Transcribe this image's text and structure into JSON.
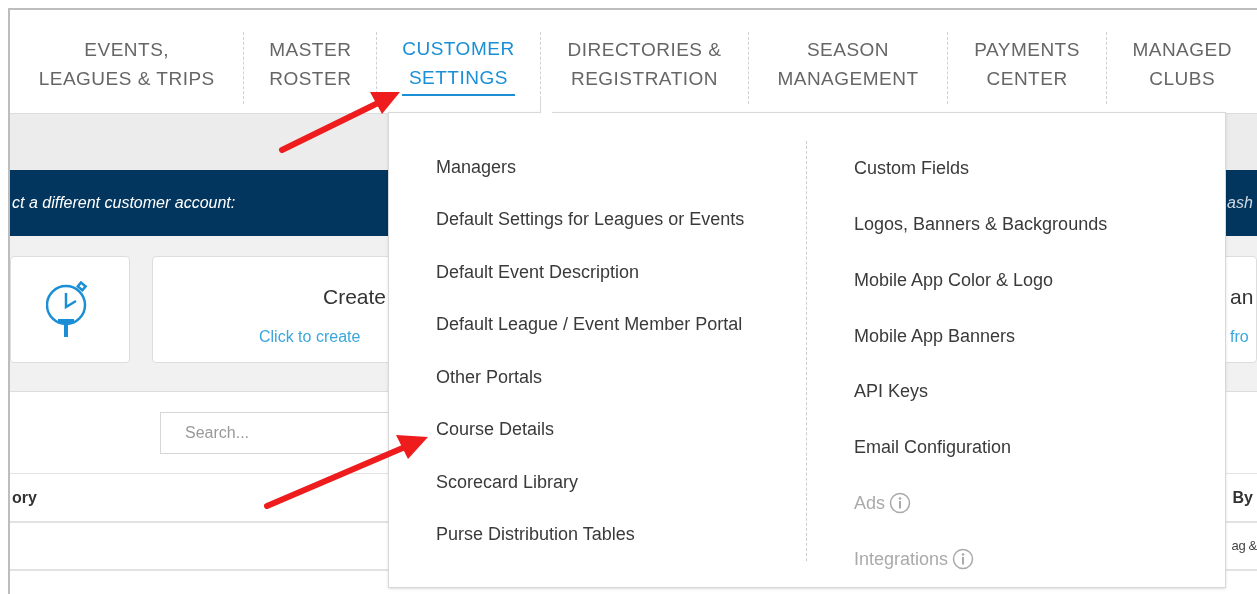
{
  "tabs": [
    {
      "lines": [
        "EVENTS,",
        "LEAGUES & TRIPS"
      ],
      "selected": false
    },
    {
      "lines": [
        "MASTER",
        "ROSTER"
      ],
      "selected": false
    },
    {
      "lines": [
        "CUSTOMER",
        "SETTINGS"
      ],
      "selected": true
    },
    {
      "lines": [
        "DIRECTORIES &",
        "REGISTRATION"
      ],
      "selected": false
    },
    {
      "lines": [
        "SEASON",
        "MANAGEMENT"
      ],
      "selected": false
    },
    {
      "lines": [
        "PAYMENTS",
        "CENTER"
      ],
      "selected": false
    },
    {
      "lines": [
        "MANAGED",
        "CLUBS"
      ],
      "selected": false
    }
  ],
  "banner": {
    "prompt": "ct a different customer account:",
    "account": "ash"
  },
  "cards": {
    "create_title": "Create",
    "create_link": "Click to create",
    "right_title": "an",
    "right_link": "fro"
  },
  "search": {
    "placeholder": "Search..."
  },
  "table": {
    "columns": [
      "ory",
      "By"
    ],
    "rows": [
      {
        "column_2": "ag &"
      }
    ]
  },
  "menu": {
    "columns": [
      [
        {
          "label": "Managers",
          "disabled": false
        },
        {
          "label": "Default Settings for Leagues or Events",
          "disabled": false
        },
        {
          "label": "Default Event Description",
          "disabled": false
        },
        {
          "label": "Default League / Event Member Portal",
          "disabled": false
        },
        {
          "label": "Other Portals",
          "disabled": false
        },
        {
          "label": "Course Details",
          "disabled": false
        },
        {
          "label": "Scorecard Library",
          "disabled": false
        },
        {
          "label": "Purse Distribution Tables",
          "disabled": false
        }
      ],
      [
        {
          "label": "Custom Fields",
          "disabled": false
        },
        {
          "label": "Logos, Banners & Backgrounds",
          "disabled": false
        },
        {
          "label": "Mobile App Color & Logo",
          "disabled": false
        },
        {
          "label": "Mobile App Banners",
          "disabled": false
        },
        {
          "label": "API Keys",
          "disabled": false
        },
        {
          "label": "Email Configuration",
          "disabled": false
        },
        {
          "label": "Ads",
          "disabled": true
        },
        {
          "label": "Integrations",
          "disabled": true
        }
      ]
    ]
  }
}
